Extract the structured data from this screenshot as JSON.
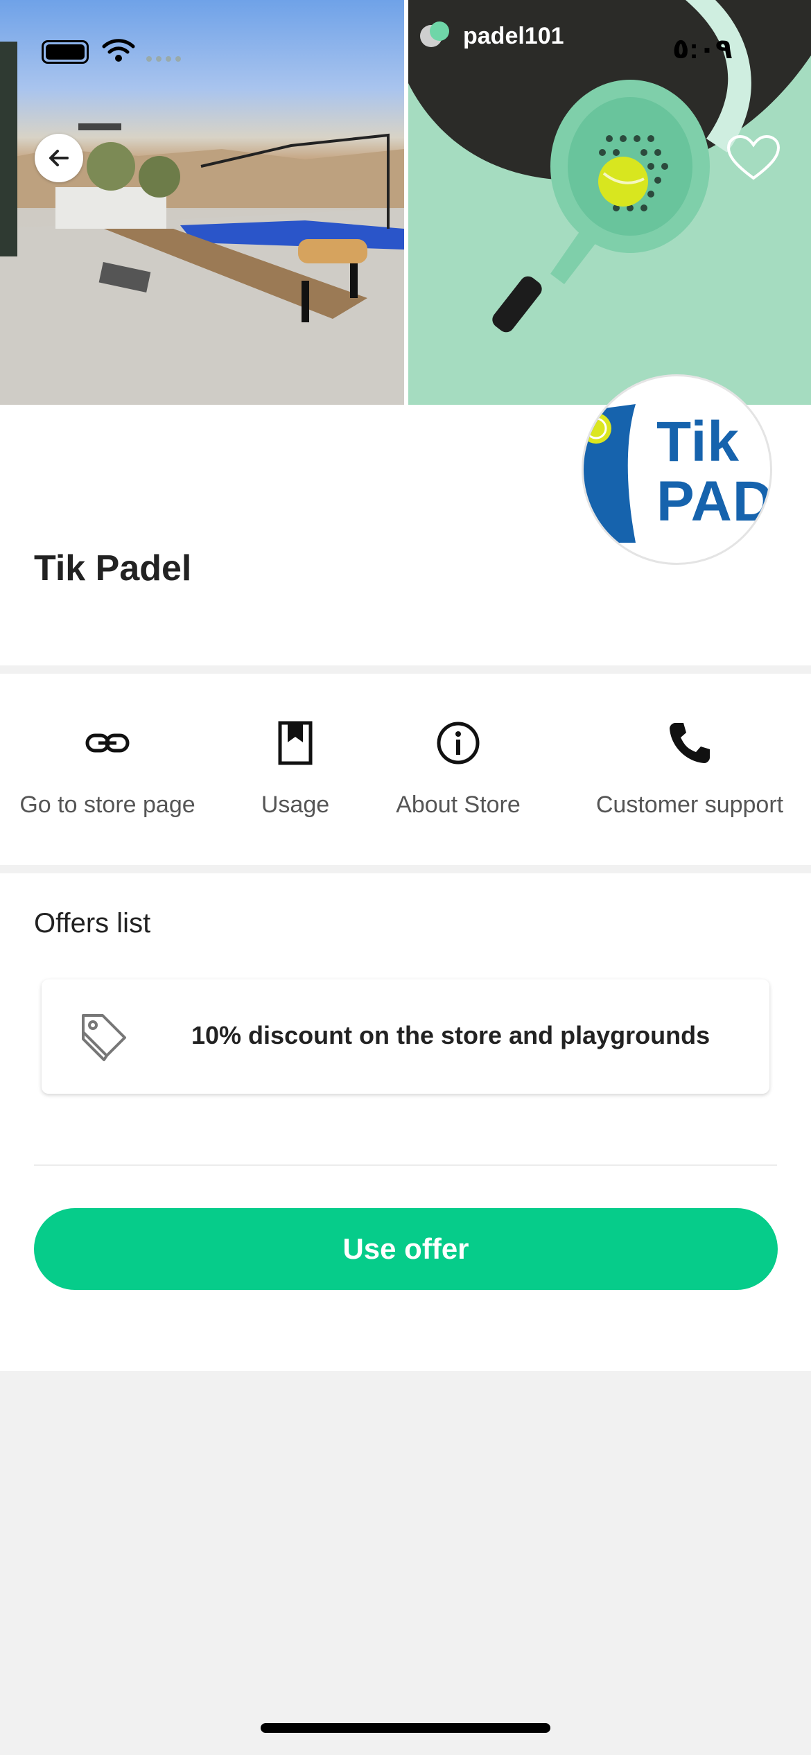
{
  "status_bar": {
    "time": "٥:٠٩"
  },
  "hero": {
    "right_brand": "padel101",
    "logo_line1": "Tik",
    "logo_line2": "PAD"
  },
  "store": {
    "name": "Tik Padel"
  },
  "actions": [
    {
      "label": "Go to store page",
      "icon": "link-icon"
    },
    {
      "label": "Usage",
      "icon": "bookmark-icon"
    },
    {
      "label": "About Store",
      "icon": "info-icon"
    },
    {
      "label": "Customer support",
      "icon": "phone-icon"
    }
  ],
  "offers": {
    "title": "Offers list",
    "items": [
      {
        "text": "10% discount on the store and playgrounds",
        "icon": "tag-icon"
      }
    ],
    "cta": "Use offer"
  },
  "colors": {
    "accent": "#06cc8a",
    "logo_blue": "#1663ad",
    "mint": "#a5dcc0"
  }
}
